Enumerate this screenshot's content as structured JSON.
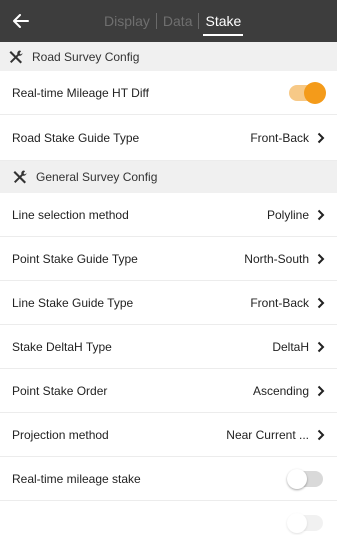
{
  "header": {
    "back_icon": "arrow-left-icon",
    "tabs": [
      {
        "label": "Display",
        "active": false
      },
      {
        "label": "Data",
        "active": false
      },
      {
        "label": "Stake",
        "active": true
      }
    ]
  },
  "road_section": {
    "icon": "tools-icon",
    "title": "Road Survey Config",
    "realtime_ht_diff": {
      "label": "Real-time Mileage HT Diff",
      "enabled": true
    },
    "guide_type": {
      "label": "Road Stake Guide Type",
      "value": "Front-Back"
    }
  },
  "general_section": {
    "icon": "tools-icon",
    "title": "General Survey Config",
    "items": [
      {
        "label": "Line selection method",
        "value": "Polyline"
      },
      {
        "label": "Point Stake Guide Type",
        "value": "North-South"
      },
      {
        "label": "Line Stake Guide Type",
        "value": "Front-Back"
      },
      {
        "label": "Stake DeltaH Type",
        "value": "DeltaH"
      },
      {
        "label": "Point Stake Order",
        "value": "Ascending"
      },
      {
        "label": "Projection method",
        "value": "Near Current ..."
      }
    ],
    "realtime_mileage_stake": {
      "label": "Real-time mileage stake",
      "enabled": false
    }
  },
  "colors": {
    "header_bg": "#3d3d3d",
    "accent": "#f49b1a",
    "section_bg": "#f0f0f0"
  }
}
